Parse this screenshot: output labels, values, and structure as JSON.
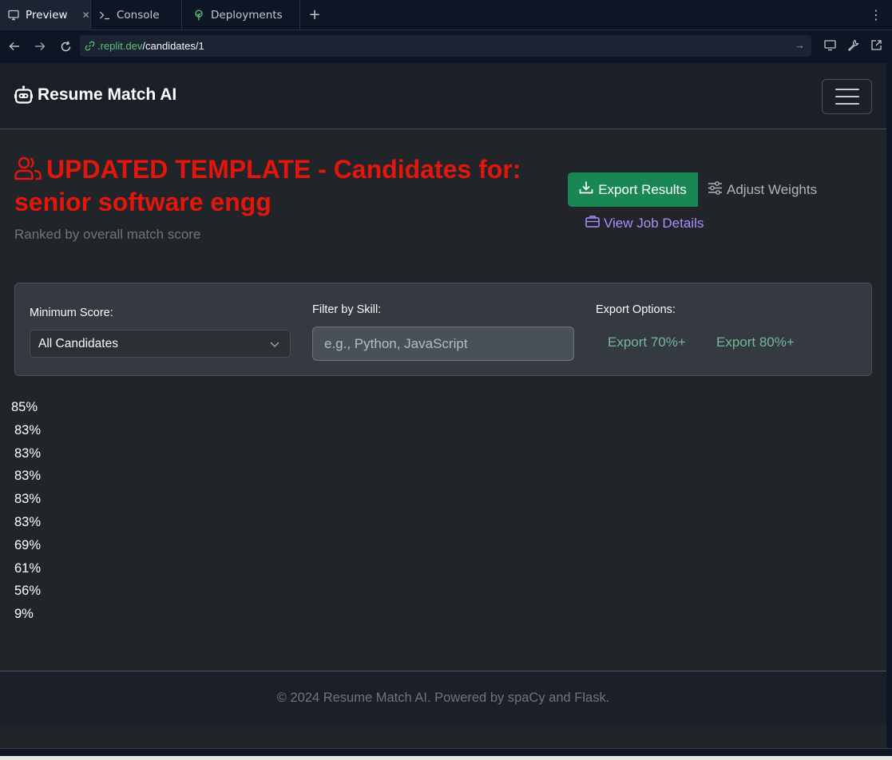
{
  "tabs": [
    {
      "label": "Preview",
      "icon": "monitor-icon",
      "active": true
    },
    {
      "label": "Console",
      "icon": "terminal-icon",
      "active": false
    },
    {
      "label": "Deployments",
      "icon": "deployments-icon",
      "active": false
    }
  ],
  "url": {
    "host": ".replit.dev",
    "path": "/candidates/1"
  },
  "app": {
    "brand": "Resume Match AI",
    "title": "UPDATED TEMPLATE - Candidates for: senior software engg",
    "subtitle": "Ranked by overall match score",
    "export_results": "Export Results",
    "adjust_weights": "Adjust Weights",
    "view_job_details": "View Job Details"
  },
  "filters": {
    "min_score_label": "Minimum Score:",
    "min_score_value": "All Candidates",
    "skill_label": "Filter by Skill:",
    "skill_placeholder": "e.g., Python, JavaScript",
    "export_options_label": "Export Options:",
    "export_70": "Export 70%+",
    "export_80": "Export 80%+"
  },
  "scores": [
    "85%",
    "83%",
    "83%",
    "83%",
    "83%",
    "83%",
    "69%",
    "61%",
    "56%",
    "9%"
  ],
  "footer": "© 2024 Resume Match AI. Powered by spaCy and Flask.",
  "colors": {
    "heading": "#e3160b",
    "export_button": "#198754",
    "link_purple": "#a98eff",
    "export_link_green": "#75b798",
    "url_host": "#5bc376"
  }
}
